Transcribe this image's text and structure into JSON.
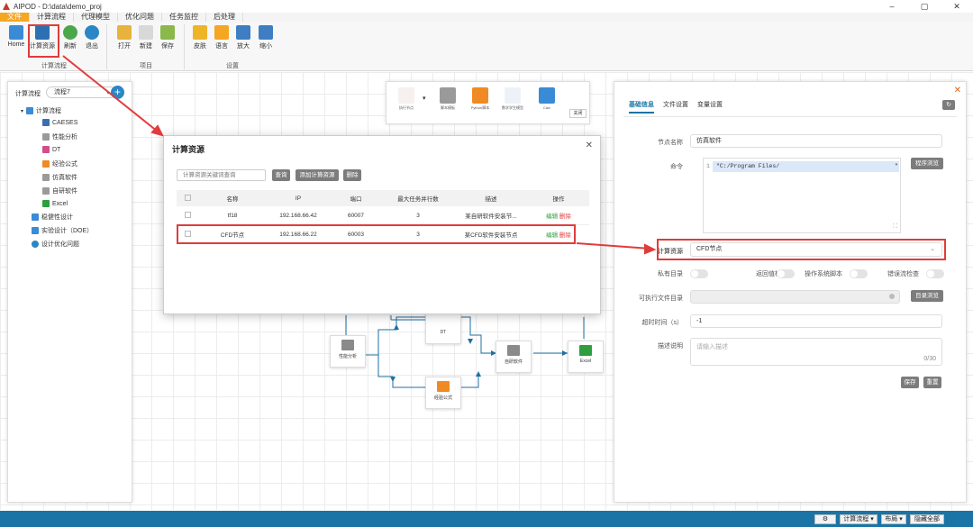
{
  "app": {
    "title": "AIPOD - D:\\data\\demo_proj",
    "minimize": "–",
    "maximize": "▢",
    "close": "✕"
  },
  "tabs": [
    "文件",
    "计算流程",
    "代理模型",
    "优化问题",
    "任务监控",
    "后处理"
  ],
  "ribbon": {
    "buttons": [
      "Home",
      "计算资源",
      "刷新",
      "退出",
      "打开",
      "新建",
      "保存",
      "皮肤",
      "语言",
      "放大",
      "缩小"
    ],
    "groups": [
      "计算流程",
      "项目",
      "设置"
    ]
  },
  "left_panel": {
    "label": "计算流程",
    "select_value": "流程7",
    "tree": [
      "计算流程",
      "CAESES",
      "性能分析",
      "DT",
      "经验公式",
      "仿真软件",
      "自研软件",
      "Excel",
      "稳健性设计",
      "实验设计（DOE）",
      "设计优化问题"
    ]
  },
  "node_toolbar": {
    "items": [
      "执行节点",
      "▾",
      "脚本模板",
      "Python脚本",
      "数学学生模型",
      "Calc"
    ],
    "close": "关闭"
  },
  "flow_nodes": [
    "DT",
    "性能分析",
    "经验公式",
    "自研软件",
    "Excel"
  ],
  "dialog": {
    "title": "计算资源",
    "close": "✕",
    "search_placeholder": "计算资源关键词查询",
    "btn_query": "查询",
    "btn_add": "添加计算资源",
    "btn_delete": "删除",
    "columns": [
      "名称",
      "IP",
      "端口",
      "最大任务并行数",
      "描述",
      "操作"
    ],
    "rows": [
      {
        "name": "tf18",
        "ip": "192.168.66.42",
        "port": "60007",
        "max": "3",
        "desc": "某自研软件安装节...",
        "edit": "编辑",
        "del": "删除"
      },
      {
        "name": "CFD节点",
        "ip": "192.168.66.22",
        "port": "60003",
        "max": "3",
        "desc": "某CFD软件安装节点",
        "edit": "编辑",
        "del": "删除"
      }
    ]
  },
  "right_panel": {
    "tabs": [
      "基础信息",
      "文件设置",
      "变量设置"
    ],
    "node_name_label": "节点名称",
    "node_name_value": "仿真软件",
    "command_label": "命令",
    "command_line_no": "1",
    "command_value": "\"C:/Program Files/",
    "command_tail": "\"",
    "program_browse": "程序浏览",
    "compute_resource_label": "计算资源",
    "compute_resource_value": "CFD节点",
    "toggles": [
      "私有目录",
      "返回值检查",
      "操作系统脚本",
      "错误流检查"
    ],
    "exec_dir_label": "可执行文件目录",
    "dir_browse": "目录浏览",
    "timeout_label": "超时时间（s）",
    "timeout_value": "-1",
    "desc_label": "描述说明",
    "desc_placeholder": "请输入描述",
    "desc_count": "0/30",
    "save": "保存",
    "reset": "重置"
  },
  "status_bar": {
    "settings": "⚙",
    "flow": "计算流程 ▾",
    "layout": "布局 ▾",
    "hide_all": "隐藏全部"
  },
  "colors": {
    "accent": "#1a74a6",
    "tab_active": "#f5a623",
    "highlight": "#e03c3c",
    "link_green": "#2e9e3e",
    "link_red": "#e03c3c"
  }
}
